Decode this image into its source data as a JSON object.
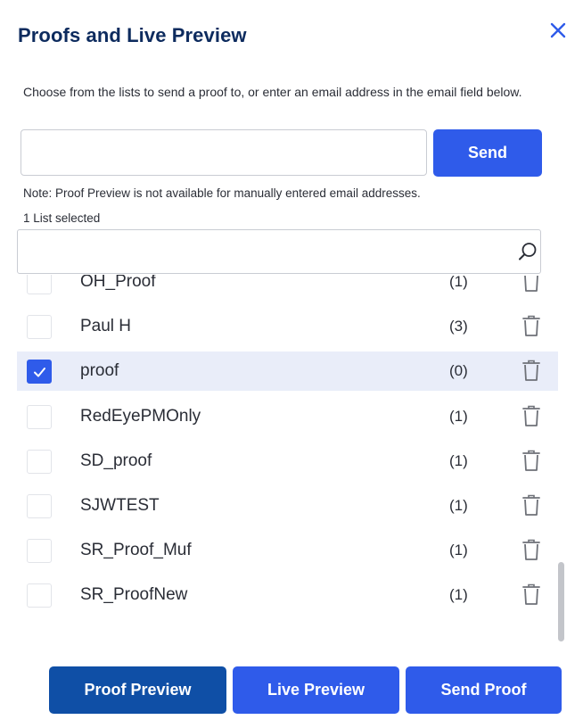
{
  "dialog": {
    "title": "Proofs and Live Preview",
    "instructions": "Choose from the lists to send a proof to, or enter an email address in the email field below.",
    "email_value": "",
    "send_label": "Send",
    "note": "Note: Proof Preview is not available for manually entered email addresses.",
    "selected_count": "1 List selected",
    "search_value": ""
  },
  "lists": [
    {
      "name": "OH_Proof",
      "count": "(1)",
      "checked": false
    },
    {
      "name": "Paul H",
      "count": "(3)",
      "checked": false
    },
    {
      "name": "proof",
      "count": "(0)",
      "checked": true
    },
    {
      "name": "RedEyePMOnly",
      "count": "(1)",
      "checked": false
    },
    {
      "name": "SD_proof",
      "count": "(1)",
      "checked": false
    },
    {
      "name": "SJWTEST",
      "count": "(1)",
      "checked": false
    },
    {
      "name": "SR_Proof_Muf",
      "count": "(1)",
      "checked": false
    },
    {
      "name": "SR_ProofNew",
      "count": "(1)",
      "checked": false
    }
  ],
  "footer": {
    "proof_preview_label": "Proof Preview",
    "live_preview_label": "Live Preview",
    "send_proof_label": "Send Proof"
  },
  "icons": {
    "close": "close-icon",
    "search": "search-icon",
    "delete": "trash-icon",
    "check": "check-icon"
  },
  "colors": {
    "primary": "#2f5bea",
    "primary_dark": "#0f4fa6",
    "title": "#0d2b5e",
    "selected_row": "#e9edf9"
  }
}
